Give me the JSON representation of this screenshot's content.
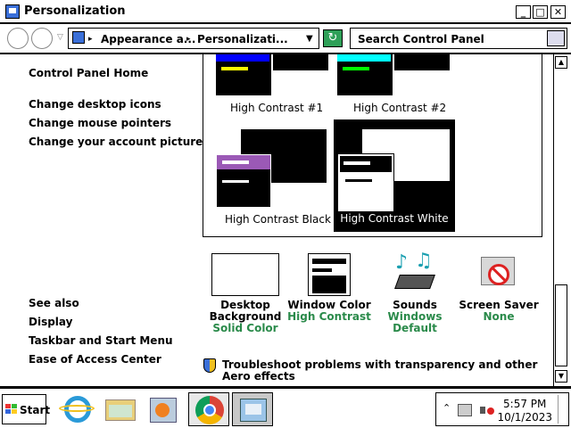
{
  "window": {
    "title": "Personalization",
    "buttons": {
      "minimize": "_",
      "maximize": "□",
      "close": "✕"
    }
  },
  "nav": {
    "breadcrumb": [
      "Appearance a...",
      "Personalizati..."
    ],
    "search_placeholder": "Search Control Panel"
  },
  "sidebar": {
    "home": "Control Panel Home",
    "links": [
      "Change desktop icons",
      "Change mouse pointers",
      "Change your account picture"
    ],
    "see_also_heading": "See also",
    "see_also": [
      "Display",
      "Taskbar and Start Menu",
      "Ease of Access Center"
    ]
  },
  "themes": [
    {
      "label": "High Contrast #1",
      "selected": false
    },
    {
      "label": "High Contrast #2",
      "selected": false
    },
    {
      "label": "High Contrast Black",
      "selected": false
    },
    {
      "label": "High Contrast White",
      "selected": true
    }
  ],
  "settings": [
    {
      "title": "Desktop Background",
      "value": "Solid Color",
      "icon": "desktop-background-icon"
    },
    {
      "title": "Window Color",
      "value": "High Contrast",
      "icon": "window-color-icon"
    },
    {
      "title": "Sounds",
      "value": "Windows Default",
      "icon": "sounds-icon"
    },
    {
      "title": "Screen Saver",
      "value": "None",
      "icon": "screen-saver-icon"
    }
  ],
  "troubleshoot": "Troubleshoot problems with transparency and other Aero effects",
  "taskbar": {
    "start_label": "Start",
    "time": "5:57 PM",
    "date": "10/1/2023"
  },
  "colors": {
    "accent_green": "#2a8a4a",
    "hc1_bar": "#0000ff",
    "hc2_bar": "#00ffff",
    "black_bar": "#9b59b6"
  }
}
